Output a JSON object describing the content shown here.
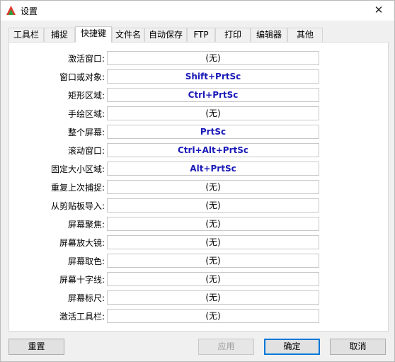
{
  "window": {
    "title": "设置",
    "close_glyph": "✕"
  },
  "tabs": [
    {
      "label": "工具栏",
      "active": false
    },
    {
      "label": "捕捉",
      "active": false
    },
    {
      "label": "快捷键",
      "active": true
    },
    {
      "label": "文件名",
      "active": false
    },
    {
      "label": "自动保存",
      "active": false
    },
    {
      "label": "FTP",
      "active": false
    },
    {
      "label": "打印",
      "active": false
    },
    {
      "label": "编辑器",
      "active": false
    },
    {
      "label": "其他",
      "active": false
    }
  ],
  "hotkeys": [
    {
      "label": "激活窗口:",
      "value": "(无)"
    },
    {
      "label": "窗口或对象:",
      "value": "Shift+PrtSc"
    },
    {
      "label": "矩形区域:",
      "value": "Ctrl+PrtSc"
    },
    {
      "label": "手绘区域:",
      "value": "(无)"
    },
    {
      "label": "整个屏幕:",
      "value": "PrtSc"
    },
    {
      "label": "滚动窗口:",
      "value": "Ctrl+Alt+PrtSc"
    },
    {
      "label": "固定大小区域:",
      "value": "Alt+PrtSc"
    },
    {
      "label": "重复上次捕捉:",
      "value": "(无)"
    },
    {
      "label": "从剪贴板导入:",
      "value": "(无)"
    },
    {
      "label": "屏幕聚焦:",
      "value": "(无)"
    },
    {
      "label": "屏幕放大镜:",
      "value": "(无)"
    },
    {
      "label": "屏幕取色:",
      "value": "(无)"
    },
    {
      "label": "屏幕十字线:",
      "value": "(无)"
    },
    {
      "label": "屏幕标尺:",
      "value": "(无)"
    },
    {
      "label": "激活工具栏:",
      "value": "(无)"
    }
  ],
  "buttons": {
    "reset": "重置",
    "apply": "应用",
    "ok": "确定",
    "cancel": "取消"
  }
}
